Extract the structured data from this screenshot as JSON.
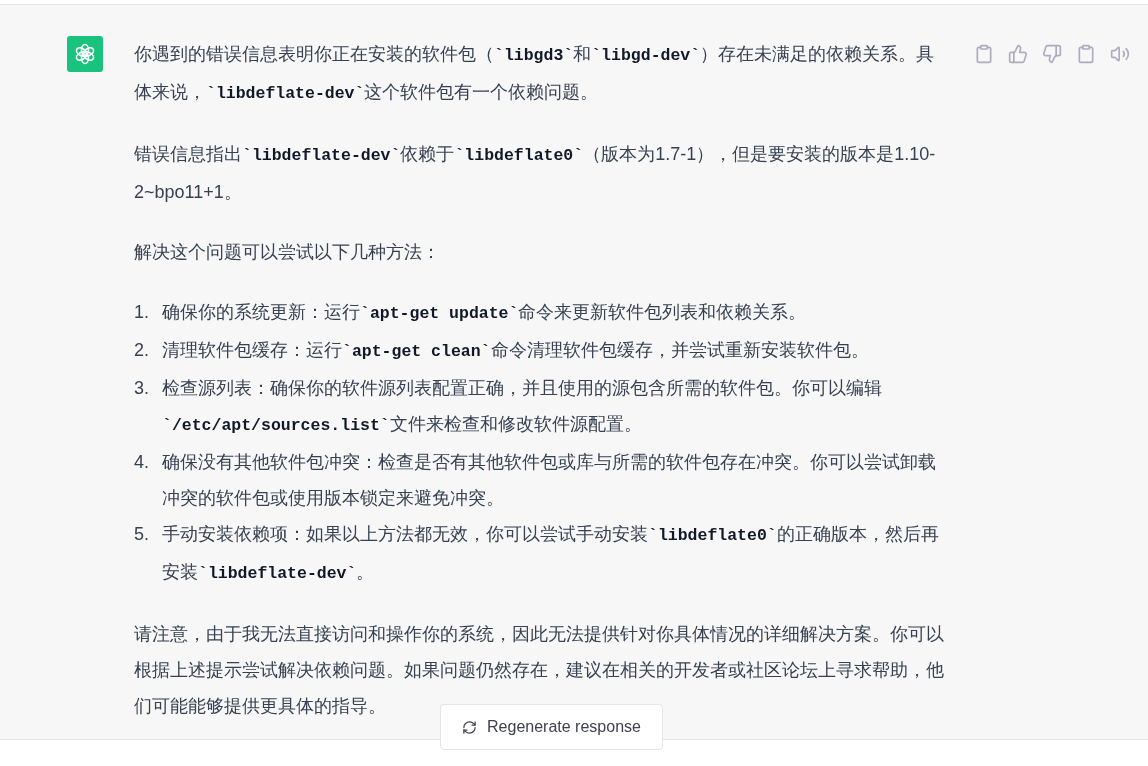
{
  "message": {
    "paragraphs_before": [
      [
        {
          "kind": "text",
          "text": "你遇到的错误信息表明你正在安装的软件包（"
        },
        {
          "kind": "code",
          "text": "`libgd3`"
        },
        {
          "kind": "text",
          "text": "和"
        },
        {
          "kind": "code",
          "text": "`libgd-dev`"
        },
        {
          "kind": "text",
          "text": "）存在未满足的依赖关系。具体来说，"
        },
        {
          "kind": "code",
          "text": "`libdeflate-dev`"
        },
        {
          "kind": "text",
          "text": "这个软件包有一个依赖问题。"
        }
      ],
      [
        {
          "kind": "text",
          "text": "错误信息指出"
        },
        {
          "kind": "code",
          "text": "`libdeflate-dev`"
        },
        {
          "kind": "text",
          "text": "依赖于"
        },
        {
          "kind": "code",
          "text": "`libdeflate0`"
        },
        {
          "kind": "text",
          "text": "（版本为1.7-1），但是要安装的版本是1.10-2~bpo11+1。"
        }
      ],
      [
        {
          "kind": "text",
          "text": "解决这个问题可以尝试以下几种方法："
        }
      ]
    ],
    "list": [
      {
        "number": "1.",
        "parts": [
          {
            "kind": "text",
            "text": "确保你的系统更新：运行"
          },
          {
            "kind": "code",
            "text": "`apt-get update`"
          },
          {
            "kind": "text",
            "text": "命令来更新软件包列表和依赖关系。"
          }
        ]
      },
      {
        "number": "2.",
        "parts": [
          {
            "kind": "text",
            "text": "清理软件包缓存：运行"
          },
          {
            "kind": "code",
            "text": "`apt-get clean`"
          },
          {
            "kind": "text",
            "text": "命令清理软件包缓存，并尝试重新安装软件包。"
          }
        ]
      },
      {
        "number": "3.",
        "parts": [
          {
            "kind": "text",
            "text": "检查源列表：确保你的软件源列表配置正确，并且使用的源包含所需的软件包。你可以编辑"
          },
          {
            "kind": "code",
            "text": "`/etc/apt/sources.list`"
          },
          {
            "kind": "text",
            "text": "文件来检查和修改软件源配置。"
          }
        ]
      },
      {
        "number": "4.",
        "parts": [
          {
            "kind": "text",
            "text": "确保没有其他软件包冲突：检查是否有其他软件包或库与所需的软件包存在冲突。你可以尝试卸载冲突的软件包或使用版本锁定来避免冲突。"
          }
        ]
      },
      {
        "number": "5.",
        "parts": [
          {
            "kind": "text",
            "text": "手动安装依赖项：如果以上方法都无效，你可以尝试手动安装"
          },
          {
            "kind": "code",
            "text": "`libdeflate0`"
          },
          {
            "kind": "text",
            "text": "的正确版本，然后再安装"
          },
          {
            "kind": "code",
            "text": "`libdeflate-dev`"
          },
          {
            "kind": "text",
            "text": "。"
          }
        ]
      }
    ],
    "paragraphs_after": [
      [
        {
          "kind": "text",
          "text": "请注意，由于我无法直接访问和操作你的系统，因此无法提供针对你具体情况的详细解决方案。你可以根据上述提示尝试解决依赖问题。如果问题仍然存在，建议在相关的开发者或社区论坛上寻求帮助，他们可能能够提供更具体的指导。"
        }
      ]
    ]
  },
  "regenerate_button": {
    "label": "Regenerate response"
  }
}
